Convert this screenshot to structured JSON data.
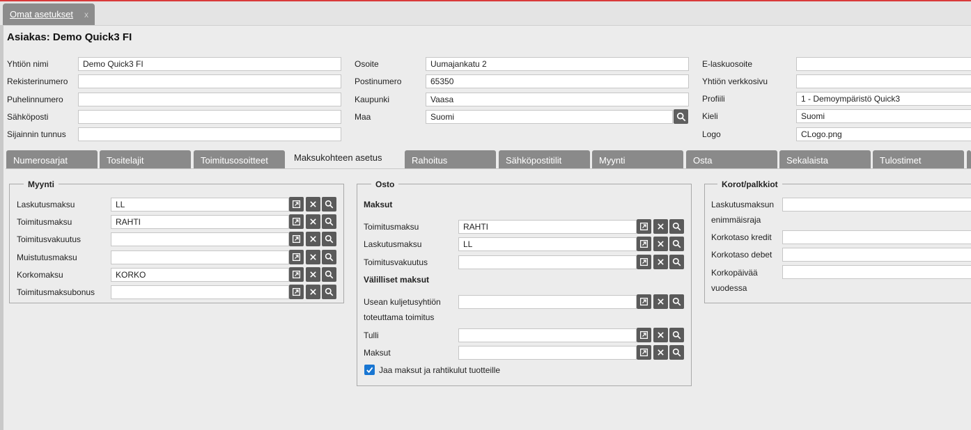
{
  "doc_tab": {
    "label": "Omat asetukset",
    "close": "x"
  },
  "page_title": "Asiakas: Demo Quick3 FI",
  "company": {
    "name_label": "Yhtiön nimi",
    "name_value": "Demo Quick3 FI",
    "reg_label": "Rekisterinumero",
    "reg_value": "",
    "phone_label": "Puhelinnumero",
    "phone_value": "",
    "email_label": "Sähköposti",
    "email_value": "",
    "location_label": "Sijainnin tunnus",
    "location_value": "",
    "address_label": "Osoite",
    "address_value": "Uumajankatu 2",
    "postal_label": "Postinumero",
    "postal_value": "65350",
    "city_label": "Kaupunki",
    "city_value": "Vaasa",
    "country_label": "Maa",
    "country_value": "Suomi",
    "einvoice_label": "E-laskuosoite",
    "einvoice_value": "",
    "website_label": "Yhtiön verkkosivu",
    "website_value": "",
    "profile_label": "Profiili",
    "profile_value": "1 - Demoympäristö Quick3",
    "language_label": "Kieli",
    "language_value": "Suomi",
    "logo_label": "Logo",
    "logo_value": "CLogo.png"
  },
  "tabs": [
    "Numerosarjat",
    "Tositelajit",
    "Toimitusosoitteet",
    "Maksukohteen asetus",
    "Rahoitus",
    "Sähköpostitilit",
    "Myynti",
    "Osta",
    "Sekalaista",
    "Tulostimet"
  ],
  "sales": {
    "legend": "Myynti",
    "rows": [
      {
        "label": "Laskutusmaksu",
        "value": "LL"
      },
      {
        "label": "Toimitusmaksu",
        "value": "RAHTI"
      },
      {
        "label": "Toimitusvakuutus",
        "value": ""
      },
      {
        "label": "Muistutusmaksu",
        "value": ""
      },
      {
        "label": "Korkomaksu",
        "value": "KORKO"
      },
      {
        "label": "Toimitusmaksubonus",
        "value": ""
      }
    ]
  },
  "purchase": {
    "legend": "Osto",
    "fees_title": "Maksut",
    "rows": [
      {
        "label": "Toimitusmaksu",
        "value": "RAHTI"
      },
      {
        "label": "Laskutusmaksu",
        "value": "LL"
      },
      {
        "label": "Toimitusvakuutus",
        "value": ""
      }
    ],
    "indirect_title": "Välilliset maksut",
    "indirect_rows": [
      {
        "label1": "Usean kuljetusyhtiön",
        "label2": "toteuttama toimitus",
        "value": ""
      },
      {
        "label1": "Tulli",
        "label2": "",
        "value": ""
      },
      {
        "label1": "Maksut",
        "label2": "",
        "value": ""
      }
    ],
    "checkbox_label": "Jaa maksut ja rahtikulut tuotteille",
    "checkbox_checked": true
  },
  "interest": {
    "legend": "Korot/palkkiot",
    "rows": [
      {
        "label1": "Laskutusmaksun",
        "label2": "enimmäisraja",
        "value": ""
      },
      {
        "label1": "Korkotaso kredit",
        "label2": "",
        "value": ""
      },
      {
        "label1": "Korkotaso debet",
        "label2": "",
        "value": ""
      },
      {
        "label1": "Korkopäivää",
        "label2": "vuodessa",
        "value": ""
      }
    ]
  },
  "colors": {
    "accent": "#1976d2",
    "tab_bg": "#8a8a8a",
    "icon_btn": "#5a5a5a",
    "top_line": "#d93a3a"
  },
  "icons": {
    "open": "external-link-icon",
    "clear": "close-icon",
    "search": "search-icon"
  }
}
